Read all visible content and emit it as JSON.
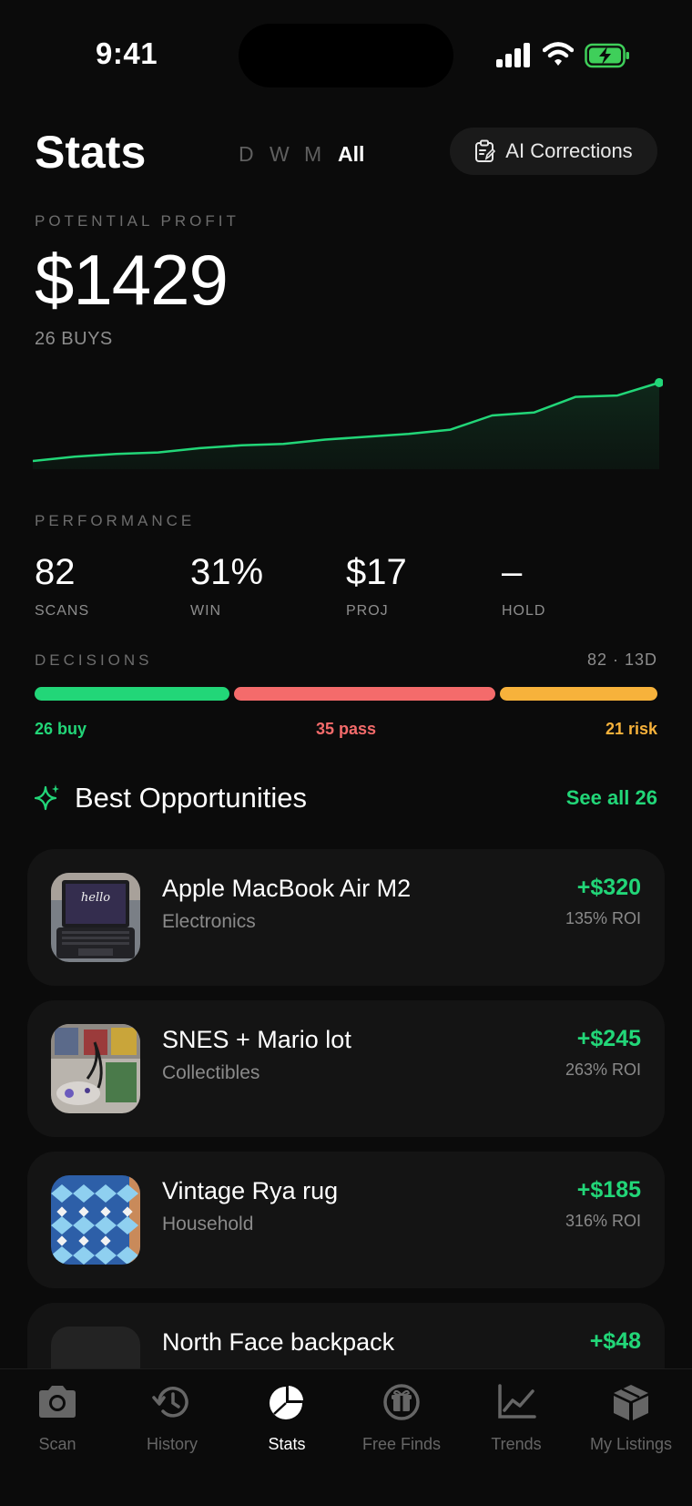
{
  "status_bar": {
    "time": "9:41"
  },
  "header": {
    "title": "Stats",
    "filters": [
      "D",
      "W",
      "M",
      "All"
    ],
    "active_filter": "All",
    "ai_button_label": "AI Corrections"
  },
  "profit": {
    "caption": "POTENTIAL PROFIT",
    "value": "$1429",
    "buys": "26 BUYS"
  },
  "chart_data": {
    "type": "area",
    "title": "",
    "xlabel": "",
    "ylabel": "",
    "grid": false,
    "series": [
      {
        "values": [
          0,
          3,
          5,
          6,
          9,
          11,
          12,
          15,
          17,
          19,
          22,
          32,
          34,
          45,
          46,
          55
        ]
      }
    ],
    "color": "#22d678"
  },
  "performance": {
    "caption": "PERFORMANCE",
    "stats": [
      {
        "value": "82",
        "label": "SCANS"
      },
      {
        "value": "31%",
        "label": "WIN"
      },
      {
        "value": "$17",
        "label": "PROJ"
      },
      {
        "value": "–",
        "label": "HOLD"
      }
    ]
  },
  "decisions": {
    "caption": "DECISIONS",
    "summary": "82 · 13D",
    "buy_count": 26,
    "pass_count": 35,
    "risk_count": 21,
    "buy_label": "26 buy",
    "pass_label": "35 pass",
    "risk_label": "21 risk",
    "colors": {
      "buy": "#22d678",
      "pass": "#f46b6b",
      "risk": "#f7b23b"
    }
  },
  "opportunities": {
    "title": "Best Opportunities",
    "see_all": "See all 26",
    "items": [
      {
        "name": "Apple MacBook Air M2",
        "category": "Electronics",
        "profit": "+$320",
        "roi": "135% ROI",
        "thumb_text": "hello"
      },
      {
        "name": "SNES + Mario lot",
        "category": "Collectibles",
        "profit": "+$245",
        "roi": "263% ROI"
      },
      {
        "name": "Vintage Rya rug",
        "category": "Household",
        "profit": "+$185",
        "roi": "316% ROI"
      },
      {
        "name": "North Face backpack",
        "category": "",
        "profit": "+$48",
        "roi": ""
      }
    ]
  },
  "tabbar": {
    "tabs": [
      {
        "label": "Scan",
        "icon": "camera-icon"
      },
      {
        "label": "History",
        "icon": "history-icon"
      },
      {
        "label": "Stats",
        "icon": "pie-chart-icon"
      },
      {
        "label": "Free Finds",
        "icon": "gift-icon"
      },
      {
        "label": "Trends",
        "icon": "trend-chart-icon"
      },
      {
        "label": "My Listings",
        "icon": "box-icon"
      }
    ],
    "active": "Stats"
  }
}
